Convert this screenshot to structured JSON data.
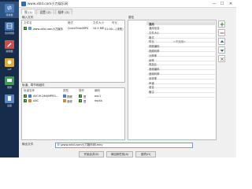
{
  "sidebar": {
    "items": [
      {
        "label": "转换器",
        "icon": "convert-icon",
        "color": "#4a7ab8"
      },
      {
        "label": "合并视频",
        "icon": "merge-icon",
        "color": "#3b6fb0"
      },
      {
        "label": "编辑器",
        "icon": "editor-icon",
        "color": "#c94f4f"
      },
      {
        "label": "GIF",
        "icon": "gif-icon",
        "color": "#e0a93a"
      },
      {
        "label": "录屏",
        "icon": "record-icon",
        "color": "#3f9a5a"
      },
      {
        "label": "设备",
        "icon": "device-icon",
        "color": "#5b88c4"
      }
    ]
  },
  "window": {
    "title": "www.xkld.com小刀娱乐网",
    "minimize": "—",
    "maximize": "☐",
    "close": "✕"
  },
  "tabs": [
    {
      "label": "简 (1)"
    },
    {
      "label": "设置 (2)"
    },
    {
      "label": "插件 (3)"
    }
  ],
  "input_files": {
    "label": "输入文件",
    "columns": {
      "name": "文件名",
      "format": "格式",
      "size": "文件大小",
      "duration": "时长"
    },
    "rows": [
      {
        "name": "www.xkld.com小刀娱乐",
        "format": "QuickTime/MP4",
        "size": "14.5 MB",
        "duration": "01:00:...(未知)"
      }
    ]
  },
  "tracks": {
    "label": "轨道、章节和组件",
    "columns": {
      "name": "轨道名称",
      "type": "类型",
      "action": "操作",
      "codec": "编码"
    },
    "rows": [
      {
        "name": "AVC/H.264/MPEG...",
        "type": "视频",
        "action": "是",
        "codec": "avc1"
      },
      {
        "name": "AAC",
        "type": "音频",
        "action": "是",
        "codec": "mp4a"
      }
    ]
  },
  "properties": {
    "label": "属性",
    "header": "通用",
    "rows": [
      {
        "label": "通用信息",
        "value": ""
      },
      {
        "label": "文件大小",
        "value": ""
      },
      {
        "label": "格式",
        "value": ""
      },
      {
        "label": "时长",
        "value": "<不适用>"
      },
      {
        "label": "视频编码",
        "value": ""
      },
      {
        "label": "视频码率",
        "value": ""
      },
      {
        "label": "分辨率",
        "value": ""
      },
      {
        "label": "帧率",
        "value": ""
      },
      {
        "label": "宽高比",
        "value": ""
      },
      {
        "label": "音频编码",
        "value": ""
      },
      {
        "label": "音频码率",
        "value": ""
      },
      {
        "label": "采样率",
        "value": ""
      },
      {
        "label": "声道",
        "value": ""
      },
      {
        "label": "语言",
        "value": ""
      },
      {
        "label": "备注",
        "value": ""
      }
    ]
  },
  "output": {
    "label": "输出文件",
    "path": "E:\\www.xkld.com小刀娱乐网.mkv"
  },
  "bottom_buttons": [
    {
      "label": "开始合并(S)"
    },
    {
      "label": "添加到任务(A)"
    },
    {
      "label": "选项(O)"
    }
  ],
  "side_buttons": [
    {
      "icon": "add-icon"
    },
    {
      "icon": "remove-icon"
    },
    {
      "icon": "move-up-icon"
    },
    {
      "icon": "move-down-icon"
    },
    {
      "icon": "clear-icon"
    }
  ]
}
